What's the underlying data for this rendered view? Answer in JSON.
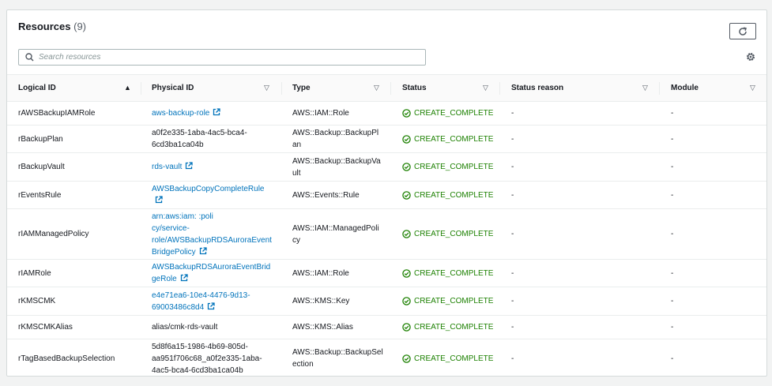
{
  "header": {
    "title": "Resources",
    "count": "(9)"
  },
  "search": {
    "placeholder": "Search resources"
  },
  "columns": [
    "Logical ID",
    "Physical ID",
    "Type",
    "Status",
    "Status reason",
    "Module"
  ],
  "rows": [
    {
      "logical_id": "rAWSBackupIAMRole",
      "physical_id": [
        "aws-backup-role"
      ],
      "physical_link": true,
      "type": [
        "AWS::IAM::Role"
      ],
      "status": "CREATE_COMPLETE",
      "reason": "-",
      "module": "-"
    },
    {
      "logical_id": "rBackupPlan",
      "physical_id": [
        "a0f2e335-1aba-4ac5-bca4-",
        "6cd3ba1ca04b"
      ],
      "physical_link": false,
      "type": [
        "AWS::Backup::BackupPl",
        "an"
      ],
      "status": "CREATE_COMPLETE",
      "reason": "-",
      "module": "-"
    },
    {
      "logical_id": "rBackupVault",
      "physical_id": [
        "rds-vault"
      ],
      "physical_link": true,
      "type": [
        "AWS::Backup::BackupVa",
        "ult"
      ],
      "status": "CREATE_COMPLETE",
      "reason": "-",
      "module": "-"
    },
    {
      "logical_id": "rEventsRule",
      "physical_id": [
        "AWSBackupCopyCompleteRule",
        ""
      ],
      "physical_link": true,
      "type": [
        "AWS::Events::Rule"
      ],
      "status": "CREATE_COMPLETE",
      "reason": "-",
      "module": "-"
    },
    {
      "logical_id": "rIAMManagedPolicy",
      "physical_id": [
        "arn:aws:iam:                         :poli",
        "cy/service-",
        "role/AWSBackupRDSAuroraEvent",
        "BridgePolicy"
      ],
      "physical_link": true,
      "type": [
        "AWS::IAM::ManagedPoli",
        "cy"
      ],
      "status": "CREATE_COMPLETE",
      "reason": "-",
      "module": "-"
    },
    {
      "logical_id": "rIAMRole",
      "physical_id": [
        "AWSBackupRDSAuroraEventBrid",
        "geRole"
      ],
      "physical_link": true,
      "type": [
        "AWS::IAM::Role"
      ],
      "status": "CREATE_COMPLETE",
      "reason": "-",
      "module": "-"
    },
    {
      "logical_id": "rKMSCMK",
      "physical_id": [
        "e4e71ea6-10e4-4476-9d13-",
        "69003486c8d4"
      ],
      "physical_link": true,
      "type": [
        "AWS::KMS::Key"
      ],
      "status": "CREATE_COMPLETE",
      "reason": "-",
      "module": "-"
    },
    {
      "logical_id": "rKMSCMKAlias",
      "physical_id": [
        "alias/cmk-rds-vault"
      ],
      "physical_link": false,
      "type": [
        "AWS::KMS::Alias"
      ],
      "status": "CREATE_COMPLETE",
      "reason": "-",
      "module": "-"
    },
    {
      "logical_id": "rTagBasedBackupSelection",
      "physical_id": [
        "5d8f6a15-1986-4b69-805d-",
        "aa951f706c68_a0f2e335-1aba-",
        "4ac5-bca4-6cd3ba1ca04b"
      ],
      "physical_link": false,
      "type": [
        "AWS::Backup::BackupSel",
        "ection"
      ],
      "status": "CREATE_COMPLETE",
      "reason": "-",
      "module": "-"
    }
  ],
  "colors": {
    "link": "#0073bb",
    "success": "#1d8102",
    "text": "#16191f",
    "border": "#eaeded"
  },
  "icons": {
    "refresh": "refresh-icon",
    "search": "search-icon",
    "settings": "gear-icon",
    "external": "external-link-icon",
    "status": "check-circle-icon",
    "sort_active": "sort-ascending-icon",
    "sort": "sort-icon"
  }
}
